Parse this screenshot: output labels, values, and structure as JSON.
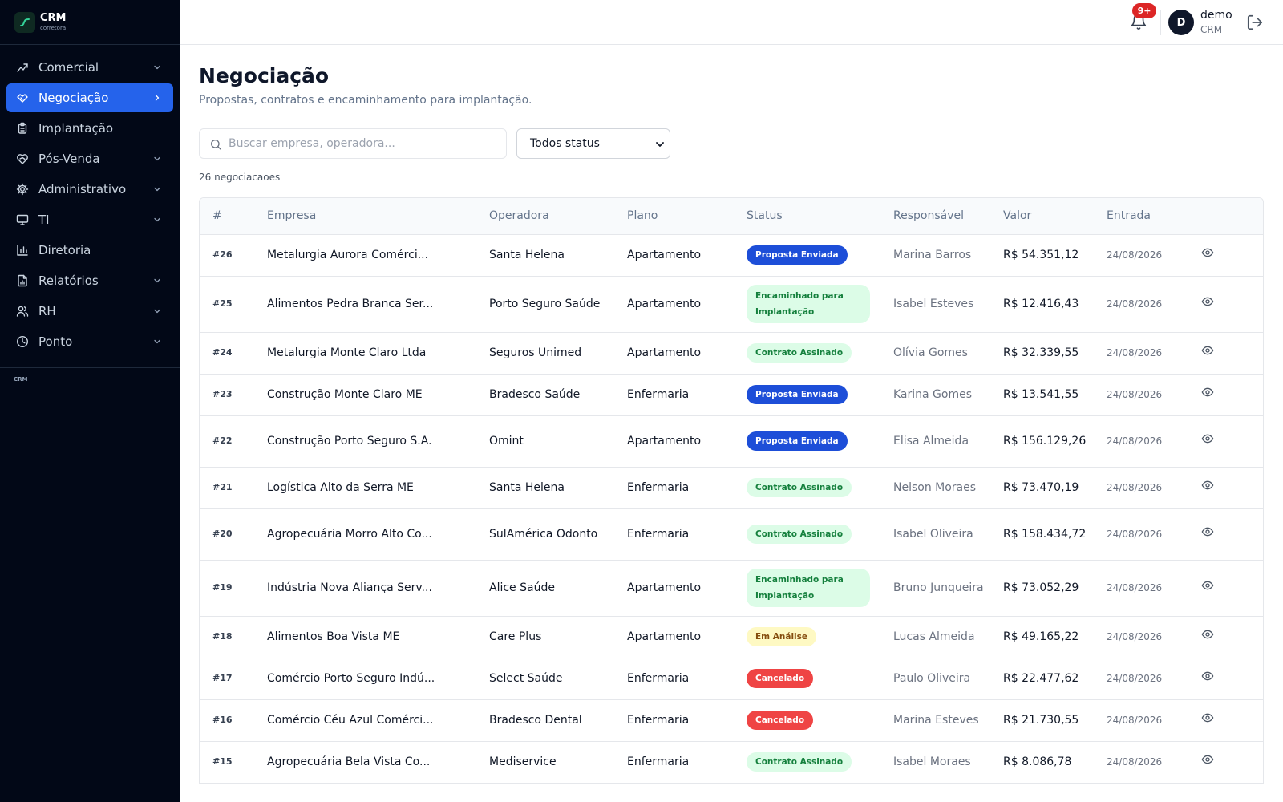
{
  "brand": {
    "name": "CRM",
    "subtitle": "corretora"
  },
  "sidebar": {
    "items": [
      {
        "label": "Comercial",
        "icon": "trending-up-icon",
        "chevron": "down",
        "active": false
      },
      {
        "label": "Negociação",
        "icon": "handshake-icon",
        "chevron": "right",
        "active": true
      },
      {
        "label": "Implantação",
        "icon": "clipboard-icon",
        "chevron": "none",
        "active": false
      },
      {
        "label": "Pós-Venda",
        "icon": "heart-handshake-icon",
        "chevron": "down",
        "active": false
      },
      {
        "label": "Administrativo",
        "icon": "gear-icon",
        "chevron": "down",
        "active": false
      },
      {
        "label": "TI",
        "icon": "monitor-icon",
        "chevron": "down",
        "active": false
      },
      {
        "label": "Diretoria",
        "icon": "bar-chart-icon",
        "chevron": "none",
        "active": false
      },
      {
        "label": "Relatórios",
        "icon": "file-chart-icon",
        "chevron": "down",
        "active": false
      },
      {
        "label": "RH",
        "icon": "users-icon",
        "chevron": "down",
        "active": false
      },
      {
        "label": "Ponto",
        "icon": "clock-icon",
        "chevron": "down",
        "active": false
      }
    ],
    "footer": "CRM"
  },
  "topbar": {
    "notifications_badge": "9+",
    "user_initial": "D",
    "user_name": "demo",
    "user_role": "CRM"
  },
  "page": {
    "title": "Negociação",
    "subtitle": "Propostas, contratos e encaminhamento para implantação.",
    "search_placeholder": "Buscar empresa, operadora...",
    "status_filter": "Todos status",
    "count_text": "26 negociacaoes"
  },
  "table": {
    "headers": [
      "#",
      "Empresa",
      "Operadora",
      "Plano",
      "Status",
      "Responsável",
      "Valor",
      "Entrada"
    ],
    "rows": [
      {
        "id": "#26",
        "empresa": "Metalurgia Aurora Comérci...",
        "operadora": "Santa Helena",
        "plano": "Apartamento",
        "status": "Proposta Enviada",
        "status_kind": "blue",
        "responsavel": "Marina Barros",
        "valor": "R$ 54.351,12",
        "entrada": "24/08/2026"
      },
      {
        "id": "#25",
        "empresa": "Alimentos Pedra Branca Ser...",
        "operadora": "Porto Seguro Saúde",
        "plano": "Apartamento",
        "status": "Encaminhado para Implantação",
        "status_kind": "green",
        "responsavel": "Isabel Esteves",
        "valor": "R$ 12.416,43",
        "entrada": "24/08/2026"
      },
      {
        "id": "#24",
        "empresa": "Metalurgia Monte Claro Ltda",
        "operadora": "Seguros Unimed",
        "plano": "Apartamento",
        "status": "Contrato Assinado",
        "status_kind": "green",
        "responsavel": "Olívia Gomes",
        "valor": "R$ 32.339,55",
        "entrada": "24/08/2026"
      },
      {
        "id": "#23",
        "empresa": "Construção Monte Claro ME",
        "operadora": "Bradesco Saúde",
        "plano": "Enfermaria",
        "status": "Proposta Enviada",
        "status_kind": "blue",
        "responsavel": "Karina Gomes",
        "valor": "R$ 13.541,55",
        "entrada": "24/08/2026"
      },
      {
        "id": "#22",
        "empresa": "Construção Porto Seguro S.A.",
        "operadora": "Omint",
        "plano": "Apartamento",
        "status": "Proposta Enviada",
        "status_kind": "blue",
        "responsavel": "Elisa Almeida",
        "valor": "R$ 156.129,26",
        "entrada": "24/08/2026"
      },
      {
        "id": "#21",
        "empresa": "Logística Alto da Serra ME",
        "operadora": "Santa Helena",
        "plano": "Enfermaria",
        "status": "Contrato Assinado",
        "status_kind": "green",
        "responsavel": "Nelson Moraes",
        "valor": "R$ 73.470,19",
        "entrada": "24/08/2026"
      },
      {
        "id": "#20",
        "empresa": "Agropecuária Morro Alto Co...",
        "operadora": "SulAmérica Odonto",
        "plano": "Enfermaria",
        "status": "Contrato Assinado",
        "status_kind": "green",
        "responsavel": "Isabel Oliveira",
        "valor": "R$ 158.434,72",
        "entrada": "24/08/2026"
      },
      {
        "id": "#19",
        "empresa": "Indústria Nova Aliança Serv...",
        "operadora": "Alice Saúde",
        "plano": "Apartamento",
        "status": "Encaminhado para Implantação",
        "status_kind": "green",
        "responsavel": "Bruno Junqueira",
        "valor": "R$ 73.052,29",
        "entrada": "24/08/2026"
      },
      {
        "id": "#18",
        "empresa": "Alimentos Boa Vista ME",
        "operadora": "Care Plus",
        "plano": "Apartamento",
        "status": "Em Análise",
        "status_kind": "yellow",
        "responsavel": "Lucas Almeida",
        "valor": "R$ 49.165,22",
        "entrada": "24/08/2026"
      },
      {
        "id": "#17",
        "empresa": "Comércio Porto Seguro Indú...",
        "operadora": "Select Saúde",
        "plano": "Enfermaria",
        "status": "Cancelado",
        "status_kind": "red",
        "responsavel": "Paulo Oliveira",
        "valor": "R$ 22.477,62",
        "entrada": "24/08/2026"
      },
      {
        "id": "#16",
        "empresa": "Comércio Céu Azul Comérci...",
        "operadora": "Bradesco Dental",
        "plano": "Enfermaria",
        "status": "Cancelado",
        "status_kind": "red",
        "responsavel": "Marina Esteves",
        "valor": "R$ 21.730,55",
        "entrada": "24/08/2026"
      },
      {
        "id": "#15",
        "empresa": "Agropecuária Bela Vista Co...",
        "operadora": "Mediservice",
        "plano": "Enfermaria",
        "status": "Contrato Assinado",
        "status_kind": "green",
        "responsavel": "Isabel Moraes",
        "valor": "R$ 8.086,78",
        "entrada": "24/08/2026"
      }
    ]
  },
  "colors": {
    "sidebar_bg": "#020817",
    "accent": "#2563eb",
    "status_blue": "#1d4ed8",
    "status_green_bg": "#dcfce7",
    "status_green_text": "#15803d",
    "status_yellow_bg": "#fef9c3",
    "status_yellow_text": "#854d0e",
    "status_red": "#ef4444"
  }
}
